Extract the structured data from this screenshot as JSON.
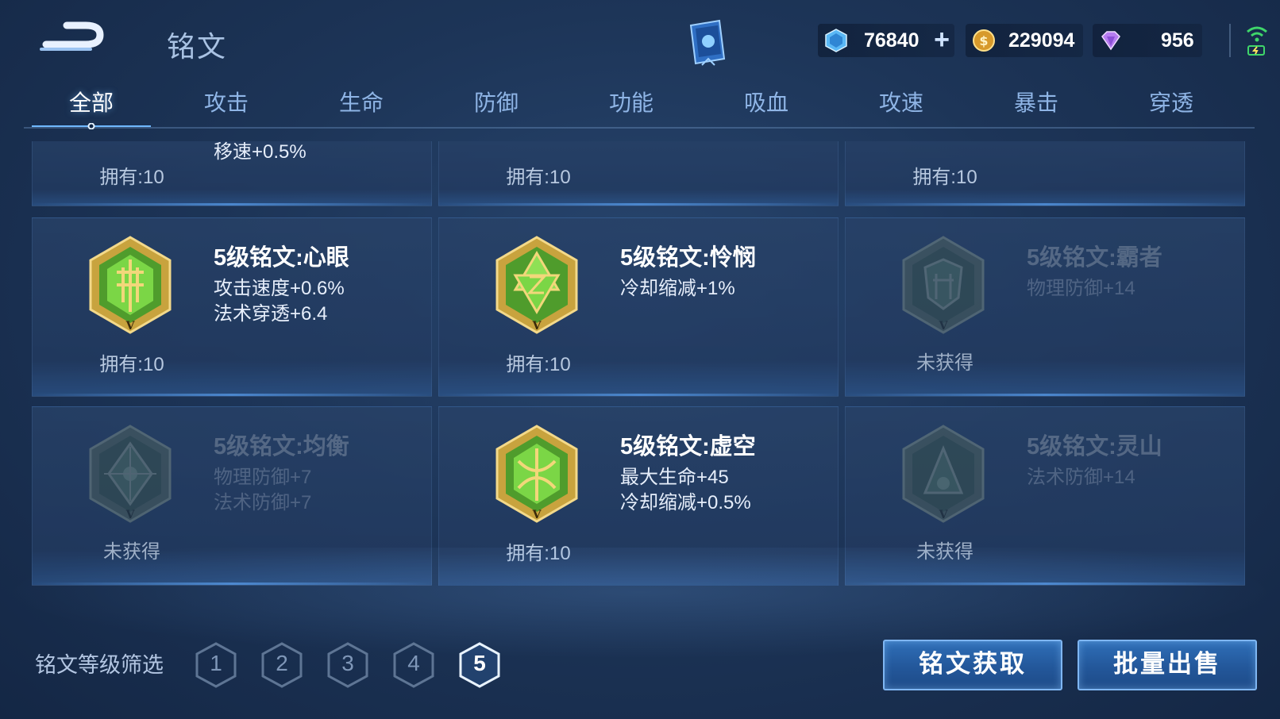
{
  "header": {
    "title": "铭文",
    "currencies": [
      {
        "icon": "diamond-crystal-icon",
        "value": "76840"
      },
      {
        "icon": "gold-coin-icon",
        "value": "229094"
      },
      {
        "icon": "purple-gem-icon",
        "value": "956"
      }
    ]
  },
  "tabs": [
    "全部",
    "攻击",
    "生命",
    "防御",
    "功能",
    "吸血",
    "攻速",
    "暴击",
    "穿透"
  ],
  "active_tab": "全部",
  "top_row": {
    "partial_stat": "移速+0.5%",
    "owned": [
      "拥有:10",
      "拥有:10",
      "拥有:10"
    ]
  },
  "cards": [
    {
      "name": "5级铭文:心眼",
      "stats": [
        "攻击速度+0.6%",
        "法术穿透+6.4"
      ],
      "status": "拥有:10",
      "locked": false,
      "icon": "xinyan-rune-icon"
    },
    {
      "name": "5级铭文:怜悯",
      "stats": [
        "冷却缩减+1%"
      ],
      "status": "拥有:10",
      "locked": false,
      "icon": "lianmin-rune-icon"
    },
    {
      "name": "5级铭文:霸者",
      "stats": [
        "物理防御+14"
      ],
      "status": "未获得",
      "locked": true,
      "icon": "bazhe-rune-icon"
    },
    {
      "name": "5级铭文:均衡",
      "stats": [
        "物理防御+7",
        "法术防御+7"
      ],
      "status": "未获得",
      "locked": true,
      "icon": "junheng-rune-icon"
    },
    {
      "name": "5级铭文:虚空",
      "stats": [
        "最大生命+45",
        "冷却缩减+0.5%"
      ],
      "status": "拥有:10",
      "locked": false,
      "icon": "xukong-rune-icon"
    },
    {
      "name": "5级铭文:灵山",
      "stats": [
        "法术防御+14"
      ],
      "status": "未获得",
      "locked": true,
      "icon": "lingshan-rune-icon"
    }
  ],
  "footer": {
    "filter_label": "铭文等级筛选",
    "levels": [
      "1",
      "2",
      "3",
      "4",
      "5"
    ],
    "active_level": "5",
    "acquire_button": "铭文获取",
    "sell_button": "批量出售"
  },
  "colors": {
    "accent": "#7fb6f2",
    "background": "#1d3558",
    "rune_gold": "#d8b24a",
    "rune_green": "#6fd23a"
  }
}
